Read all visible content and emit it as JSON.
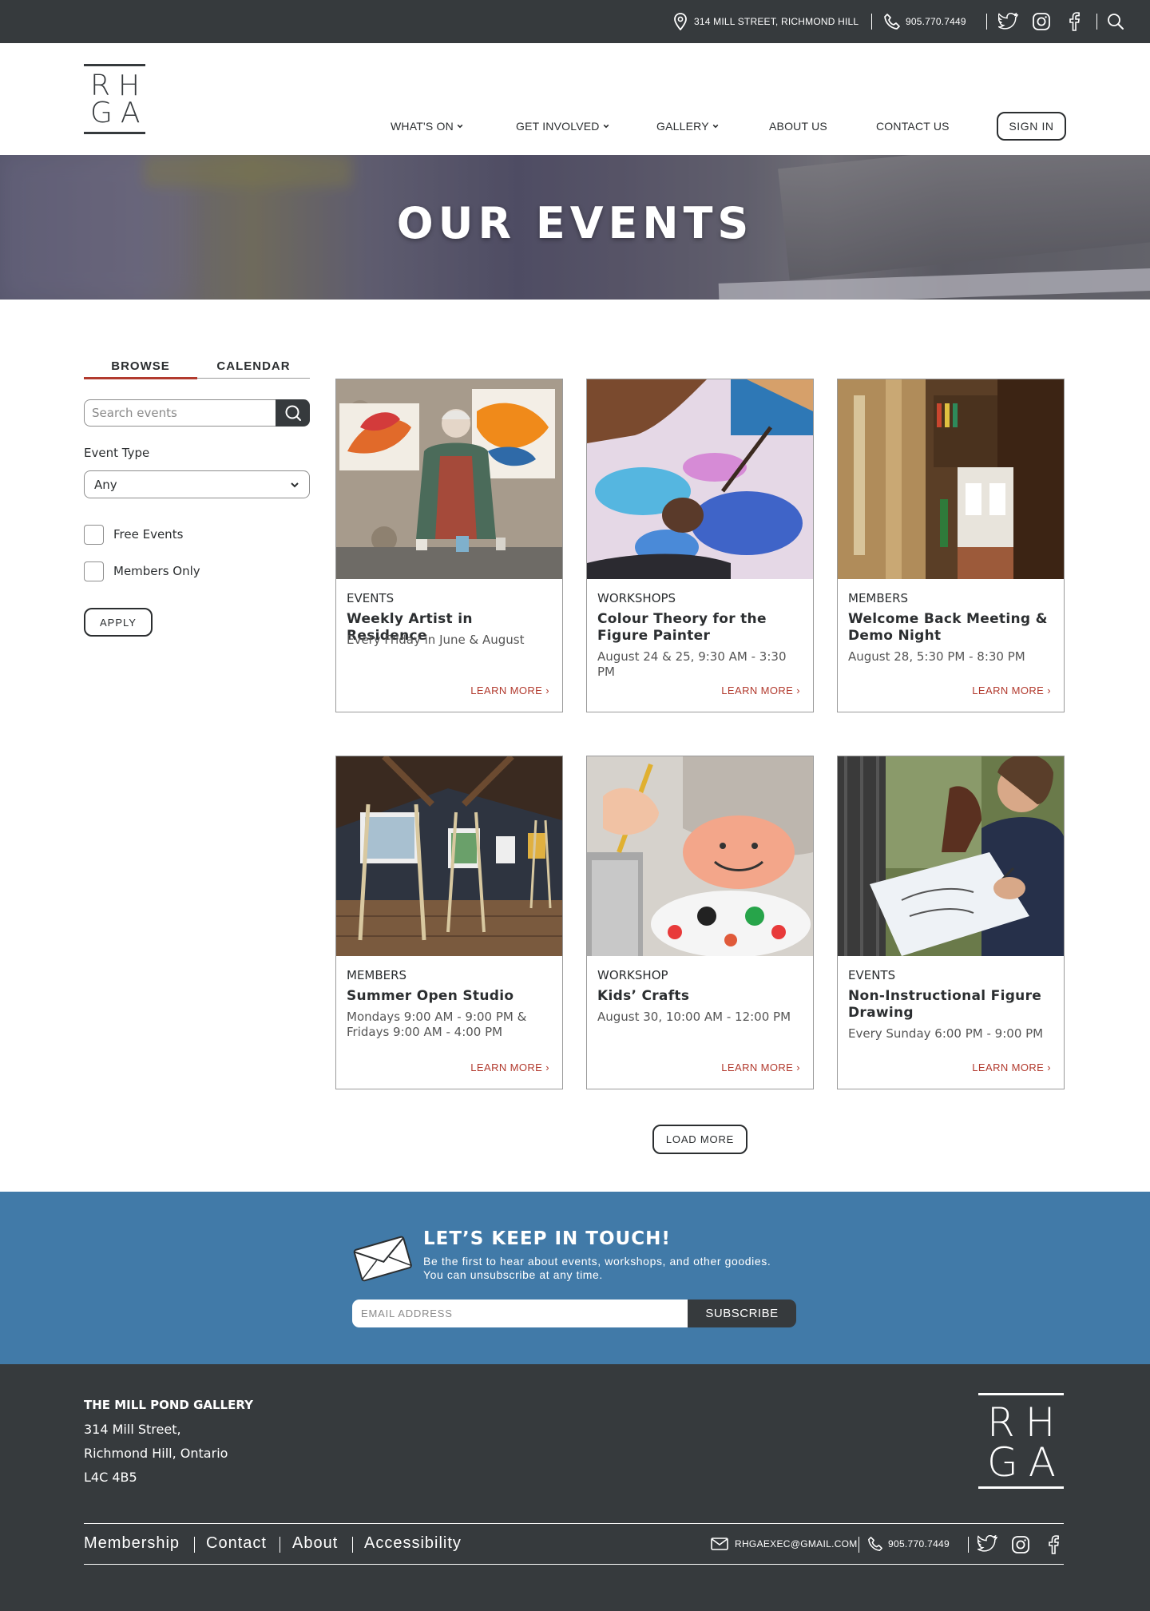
{
  "topbar": {
    "address": "314 MILL STREET, RICHMOND HILL",
    "phone": "905.770.7449",
    "icons": [
      "location-pin-icon",
      "phone-icon",
      "twitter-icon",
      "instagram-icon",
      "facebook-icon",
      "search-icon"
    ]
  },
  "header": {
    "logo_line1": "RH",
    "logo_line2": "GA",
    "nav": [
      "WHAT'S ON",
      "GET INVOLVED",
      "GALLERY",
      "ABOUT US",
      "CONTACT US"
    ],
    "signin": "SIGN IN"
  },
  "hero": {
    "title": "OUR EVENTS"
  },
  "sidebar": {
    "tabs": [
      "BROWSE",
      "CALENDAR"
    ],
    "search_placeholder": "Search events",
    "event_type_label": "Event Type",
    "event_type_value": "Any",
    "checkboxes": [
      "Free Events",
      "Members Only"
    ],
    "apply": "APPLY"
  },
  "events": [
    {
      "category": "EVENTS",
      "title": "Weekly Artist in Residence",
      "when": "Every Friday in June & August",
      "link": "LEARN MORE ›"
    },
    {
      "category": "WORKSHOPS",
      "title": "Colour Theory for the Figure Painter",
      "when": "August 24 & 25, 9:30 AM - 3:30 PM",
      "link": "LEARN MORE ›"
    },
    {
      "category": "MEMBERS",
      "title": "Welcome Back Meeting & Demo Night",
      "when": "August 28, 5:30 PM - 8:30 PM",
      "link": "LEARN MORE ›"
    },
    {
      "category": "MEMBERS",
      "title": "Summer Open Studio",
      "when": "Mondays 9:00 AM - 9:00 PM & Fridays 9:00 AM - 4:00 PM",
      "link": "LEARN MORE ›"
    },
    {
      "category": "WORKSHOP",
      "title": "Kids’ Crafts",
      "when": "August 30, 10:00 AM - 12:00 PM",
      "link": "LEARN MORE ›"
    },
    {
      "category": "EVENTS",
      "title": "Non-Instructional Figure Drawing",
      "when": "Every Sunday 6:00 PM - 9:00 PM",
      "link": "LEARN MORE ›"
    }
  ],
  "load_more": "LOAD MORE",
  "newsletter": {
    "title": "LET’S KEEP IN TOUCH!",
    "line1": "Be the first to hear about events, workshops, and other goodies.",
    "line2": "You can unsubscribe at any time.",
    "email_placeholder": "EMAIL ADDRESS",
    "subscribe": "SUBSCRIBE"
  },
  "footer": {
    "gallery_name": "THE MILL POND GALLERY",
    "address": [
      "314 Mill Street,",
      "Richmond Hill, Ontario",
      "L4C 4B5"
    ],
    "logo_line1": "RH",
    "logo_line2": "GA",
    "links": [
      "Membership",
      "Contact",
      "About",
      "Accessibility"
    ],
    "email": "RHGAEXEC@GMAIL.COM",
    "phone": "905.770.7449"
  },
  "colors": {
    "dark": "#363a3d",
    "accent_red": "#b23a2e",
    "newsletter_blue": "#417aa8"
  }
}
